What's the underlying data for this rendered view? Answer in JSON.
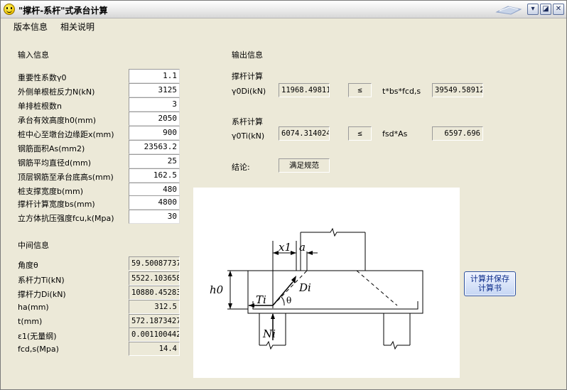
{
  "window": {
    "title": "\"撑杆-系杆\"式承台计算"
  },
  "menu": [
    "版本信息",
    "相关说明"
  ],
  "input": {
    "heading": "输入信息",
    "rows": [
      {
        "label": "重要性系数γ0",
        "value": "1.1"
      },
      {
        "label": "外侧单根桩反力N(kN)",
        "value": "3125"
      },
      {
        "label": "单排桩根数n",
        "value": "3"
      },
      {
        "label": "承台有效高度h0(mm)",
        "value": "2050"
      },
      {
        "label": "桩中心至墩台边缘距x(mm)",
        "value": "900"
      },
      {
        "label": "钢筋面积As(mm2)",
        "value": "23563.2"
      },
      {
        "label": "钢筋平均直径d(mm)",
        "value": "25"
      },
      {
        "label": "顶层钢筋至承台底高s(mm)",
        "value": "162.5"
      },
      {
        "label": "桩支撑宽度b(mm)",
        "value": "480"
      },
      {
        "label": "撑杆计算宽度bs(mm)",
        "value": "4800"
      },
      {
        "label": "立方体抗压强度fcu,k(Mpa)",
        "value": "30"
      }
    ]
  },
  "middle": {
    "heading": "中间信息",
    "rows": [
      {
        "label": "角度θ",
        "value": "59.50087737"
      },
      {
        "label": "系杆力Ti(kN)",
        "value": "5522.103658"
      },
      {
        "label": "撑杆力Di(kN)",
        "value": "10880.45283"
      },
      {
        "label": "ha(mm)",
        "value": "312.5"
      },
      {
        "label": "t(mm)",
        "value": "572.1873427"
      },
      {
        "label": "ε1(无量纲)",
        "value": "0.001100442"
      },
      {
        "label": "fcd,s(Mpa)",
        "value": "14.4"
      }
    ]
  },
  "output": {
    "heading": "输出信息",
    "strut": {
      "heading": "撑杆计算",
      "label": "γ0Di(kN)",
      "value": "11968.49811",
      "comparator": "≤",
      "rhs_label": "t*bs*fcd,s",
      "rhs_value": "39549.58912"
    },
    "tie": {
      "heading": "系杆计算",
      "label": "γ0Ti(kN)",
      "value": "6074.314024",
      "comparator": "≤",
      "rhs_label": "fsd*As",
      "rhs_value": "6597.696"
    },
    "conclusion_label": "结论:",
    "conclusion_value": "满足规范"
  },
  "diagram": {
    "labels": {
      "x1": "x1",
      "a": "a",
      "h0": "h0",
      "Ti": "Ti",
      "Di": "Di",
      "theta": "θ",
      "Ni": "Ni"
    }
  },
  "calc_button": {
    "line1": "计算并保存",
    "line2": "计算书"
  }
}
